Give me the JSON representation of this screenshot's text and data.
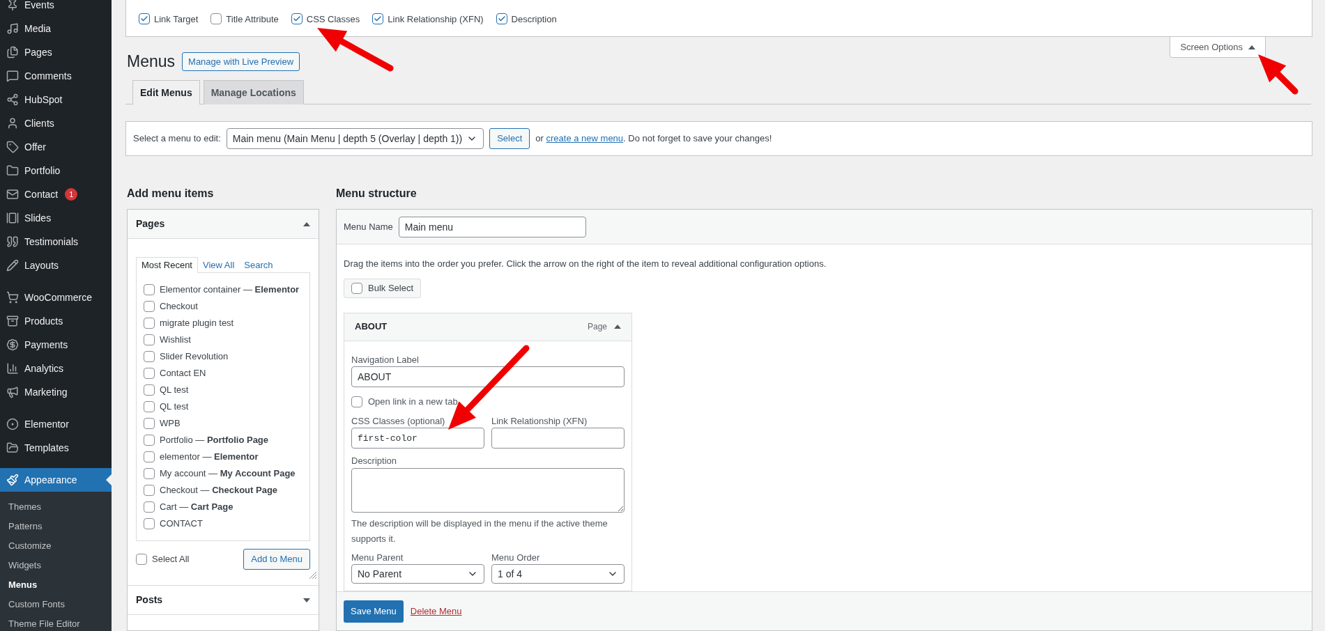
{
  "sidebar": {
    "groups": [
      {
        "items": [
          {
            "label": "Events",
            "selected": false
          },
          {
            "label": "Media",
            "selected": false
          },
          {
            "label": "Pages",
            "selected": false
          },
          {
            "label": "Comments",
            "selected": false
          },
          {
            "label": "HubSpot",
            "selected": false
          },
          {
            "label": "Clients",
            "selected": false
          },
          {
            "label": "Offer",
            "selected": false
          },
          {
            "label": "Portfolio",
            "selected": false
          },
          {
            "label": "Contact",
            "selected": false,
            "badge": "1"
          },
          {
            "label": "Slides",
            "selected": false
          },
          {
            "label": "Testimonials",
            "selected": false
          },
          {
            "label": "Layouts",
            "selected": false
          }
        ]
      },
      {
        "items": [
          {
            "label": "WooCommerce",
            "selected": false
          },
          {
            "label": "Products",
            "selected": false
          },
          {
            "label": "Payments",
            "selected": false
          },
          {
            "label": "Analytics",
            "selected": false
          },
          {
            "label": "Marketing",
            "selected": false
          }
        ]
      },
      {
        "items": [
          {
            "label": "Elementor",
            "selected": false
          },
          {
            "label": "Templates",
            "selected": false
          }
        ]
      },
      {
        "items": [
          {
            "label": "Appearance",
            "selected": true,
            "children": [
              {
                "label": "Themes",
                "selected": false
              },
              {
                "label": "Patterns",
                "selected": false
              },
              {
                "label": "Customize",
                "selected": false
              },
              {
                "label": "Widgets",
                "selected": false
              },
              {
                "label": "Menus",
                "selected": true
              },
              {
                "label": "Custom Fonts",
                "selected": false
              },
              {
                "label": "Theme File Editor",
                "selected": false
              }
            ]
          }
        ]
      }
    ]
  },
  "screen_options": {
    "checkboxes": [
      {
        "label": "Link Target",
        "checked": true
      },
      {
        "label": "Title Attribute",
        "checked": false
      },
      {
        "label": "CSS Classes",
        "checked": true
      },
      {
        "label": "Link Relationship (XFN)",
        "checked": true
      },
      {
        "label": "Description",
        "checked": true
      }
    ],
    "toggle": "Screen Options",
    "expanded": true
  },
  "page": {
    "title": "Menus",
    "live_preview_button": "Manage with Live Preview",
    "tabs": [
      {
        "label": "Edit Menus",
        "selected": true
      },
      {
        "label": "Manage Locations",
        "selected": false
      }
    ],
    "menu_select": {
      "label": "Select a menu to edit:",
      "value": "Main menu (Main Menu | depth 5 (Overlay | depth 1))",
      "button": "Select",
      "prefix": "or",
      "link": "create a new menu",
      "suffix": ". Do not forget to save your changes!"
    }
  },
  "add_items": {
    "heading": "Add menu items",
    "panels": [
      {
        "title": "Pages",
        "expanded": true,
        "tabs": [
          {
            "label": "Most Recent",
            "selected": true
          },
          {
            "label": "View All",
            "selected": false
          },
          {
            "label": "Search",
            "selected": false
          }
        ],
        "items": [
          {
            "text": "Elementor container — **Elementor**",
            "checked": false
          },
          {
            "text": "Checkout",
            "checked": false
          },
          {
            "text": "migrate plugin test",
            "checked": false
          },
          {
            "text": "Wishlist",
            "checked": false
          },
          {
            "text": "Slider Revolution",
            "checked": false
          },
          {
            "text": "Contact EN",
            "checked": false
          },
          {
            "text": "QL test",
            "checked": false
          },
          {
            "text": "QL test",
            "checked": false
          },
          {
            "text": "WPB",
            "checked": false
          },
          {
            "text": "Portfolio — **Portfolio Page**",
            "checked": false
          },
          {
            "text": "elementor — **Elementor**",
            "checked": false
          },
          {
            "text": "My account — **My Account Page**",
            "checked": false
          },
          {
            "text": "Checkout — **Checkout Page**",
            "checked": false
          },
          {
            "text": "Cart — **Cart Page**",
            "checked": false
          },
          {
            "text": "CONTACT",
            "checked": false
          }
        ],
        "select_all": {
          "label": "Select All",
          "checked": false
        },
        "button": "Add to Menu"
      },
      {
        "title": "Posts",
        "expanded": false
      }
    ]
  },
  "menu_structure": {
    "heading": "Menu structure",
    "name_label": "Menu Name",
    "name_value": "Main menu",
    "instructions": "Drag the items into the order you prefer. Click the arrow on the right of the item to reveal additional configuration options.",
    "bulk_select": {
      "label": "Bulk Select",
      "checked": false
    },
    "items": [
      {
        "title": "ABOUT",
        "type": "Page",
        "expanded": true,
        "navigation_label": {
          "label": "Navigation Label",
          "value": "ABOUT"
        },
        "new_tab": {
          "label": "Open link in a new tab",
          "checked": false
        },
        "css_classes": {
          "label": "CSS Classes (optional)",
          "value": "first-color"
        },
        "xfn": {
          "label": "Link Relationship (XFN)"
        },
        "description": {
          "label": "Description",
          "hint": "The description will be displayed in the menu if the active theme supports it."
        },
        "menu_parent": {
          "label": "Menu Parent",
          "value": "No Parent"
        },
        "menu_order": {
          "label": "Menu Order",
          "value": "1 of 4"
        }
      }
    ],
    "save_button": "Save Menu",
    "delete_link": "Delete Menu"
  }
}
